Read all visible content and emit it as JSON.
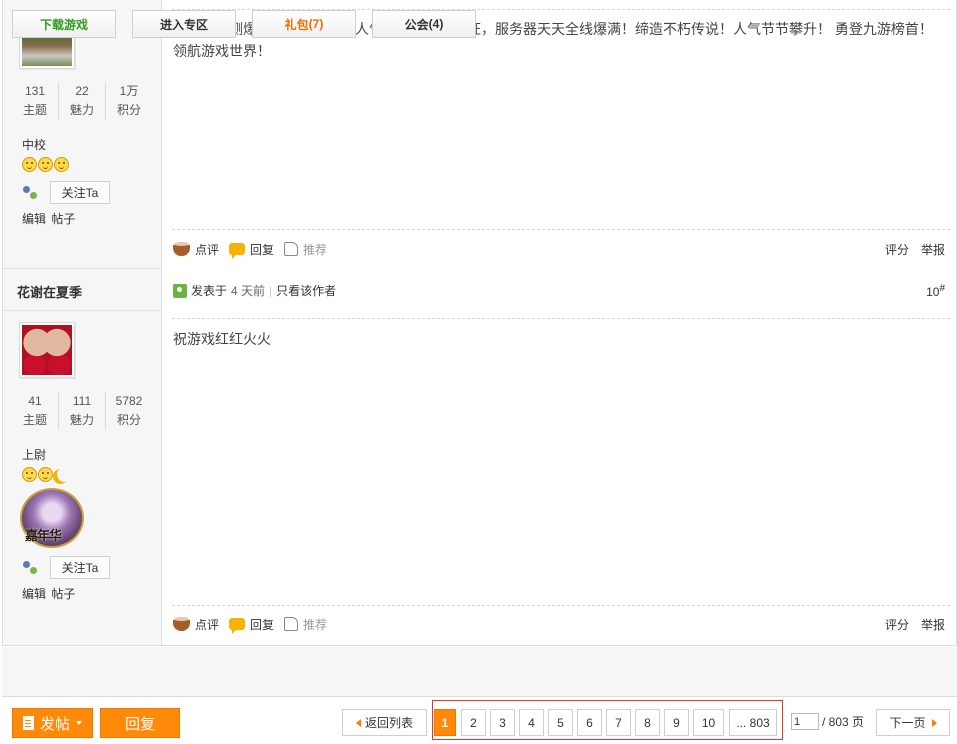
{
  "posts": [
    {
      "author": "",
      "stats": [
        {
          "value": "131",
          "label": "主题"
        },
        {
          "value": "22",
          "label": "魅力"
        },
        {
          "value": "1万",
          "label": "积分"
        }
      ],
      "rank": "中校",
      "follow_label": "关注Ta",
      "edit_label": "编辑 帖子",
      "content": "祝游戏开测爆满，红红火火，人气爆棚，旺上加旺，服务器天天全线爆满！缔造不朽传说！人气节节攀升！ 勇登九游榜首！领航游戏世界！",
      "actions": {
        "comment": "点评",
        "reply": "回复",
        "recommend": "推荐",
        "rate": "评分",
        "report": "举报"
      }
    },
    {
      "author": "花谢在夏季",
      "stats": [
        {
          "value": "41",
          "label": "主题"
        },
        {
          "value": "111",
          "label": "魅力"
        },
        {
          "value": "5782",
          "label": "积分"
        }
      ],
      "rank": "上尉",
      "medal_text": "嘉年华",
      "follow_label": "关注Ta",
      "edit_label": "编辑 帖子",
      "meta_prefix": "发表于",
      "meta_time": "4 天前",
      "meta_only_author": "只看该作者",
      "floor": "10",
      "floor_mark": "#",
      "content": "祝游戏红红火火",
      "actions": {
        "comment": "点评",
        "reply": "回复",
        "recommend": "推荐",
        "rate": "评分",
        "report": "举报"
      }
    }
  ],
  "links": {
    "download": "下载游戏",
    "zone": "进入专区",
    "gift_label": "礼包",
    "gift_count": "(7)",
    "guild_label": "公会",
    "guild_count": "(4)"
  },
  "toolbar": {
    "post_label": "发帖",
    "reply_label": "回复",
    "back_label": "返回列表",
    "pages": [
      "1",
      "2",
      "3",
      "4",
      "5",
      "6",
      "7",
      "8",
      "9",
      "10",
      "... 803"
    ],
    "current_page": "1",
    "page_input_value": "1",
    "page_total": "/ 803 页",
    "next_label": "下一页"
  },
  "colors": {
    "accent": "#ff8a0a",
    "highlight_box": "#e0392b",
    "green": "#2e9a1a"
  }
}
